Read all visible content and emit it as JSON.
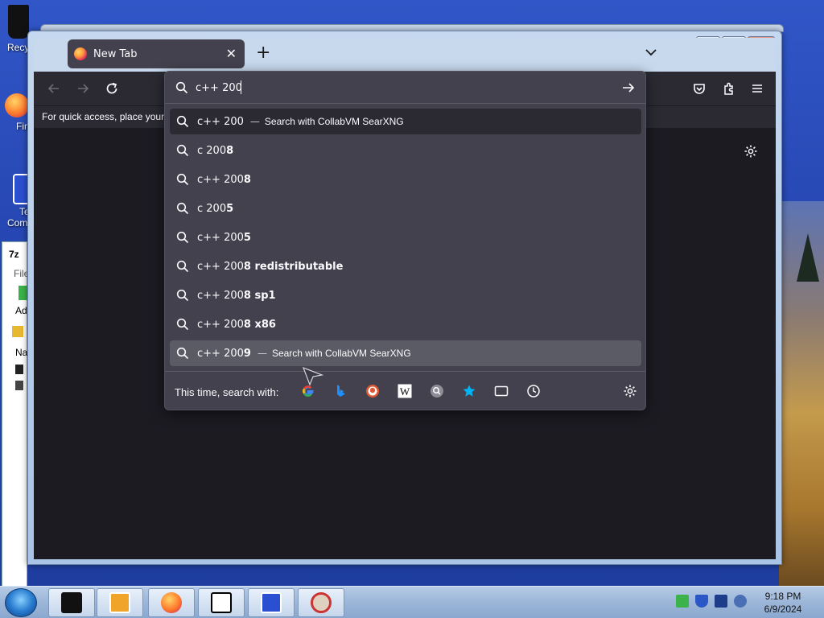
{
  "desktop": {
    "icons": [
      {
        "label": "Recy"
      },
      {
        "label": "Fir"
      },
      {
        "label": "Te"
      },
      {
        "label": "Comm"
      }
    ],
    "back_window": {
      "title": "7z",
      "menu_first": "File",
      "toolbar_first": "Ad",
      "column_first": "Na"
    }
  },
  "browser": {
    "tab": {
      "title": "New Tab"
    },
    "bookmarks_hint": "For quick access, place your l",
    "urlbar": {
      "value": "c++ 200",
      "results": [
        {
          "prefix": "c++ 200",
          "bold": "",
          "action": "Search with CollabVM SearXNG",
          "state": "selected"
        },
        {
          "prefix": "c 200",
          "bold": "8",
          "action": "",
          "state": ""
        },
        {
          "prefix": "c++ 200",
          "bold": "8",
          "action": "",
          "state": ""
        },
        {
          "prefix": "c 200",
          "bold": "5",
          "action": "",
          "state": ""
        },
        {
          "prefix": "c++ 200",
          "bold": "5",
          "action": "",
          "state": ""
        },
        {
          "prefix": "c++ 200",
          "bold": "8 redistributable",
          "action": "",
          "state": ""
        },
        {
          "prefix": "c++ 200",
          "bold": "8 sp1",
          "action": "",
          "state": ""
        },
        {
          "prefix": "c++ 200",
          "bold": "8 x86",
          "action": "",
          "state": ""
        },
        {
          "prefix": "c++ 200",
          "bold": "9",
          "action": "Search with CollabVM SearXNG",
          "state": "hover"
        }
      ],
      "oneoff_label": "This time, search with:",
      "separator": "—",
      "engines": [
        "google-icon",
        "bing-icon",
        "duckduckgo-icon",
        "wikipedia-icon",
        "searxng-icon",
        "bookmarks-icon",
        "tabs-icon",
        "history-icon"
      ]
    }
  },
  "taskbar": {
    "time": "9:18 PM",
    "date": "6/9/2024"
  }
}
